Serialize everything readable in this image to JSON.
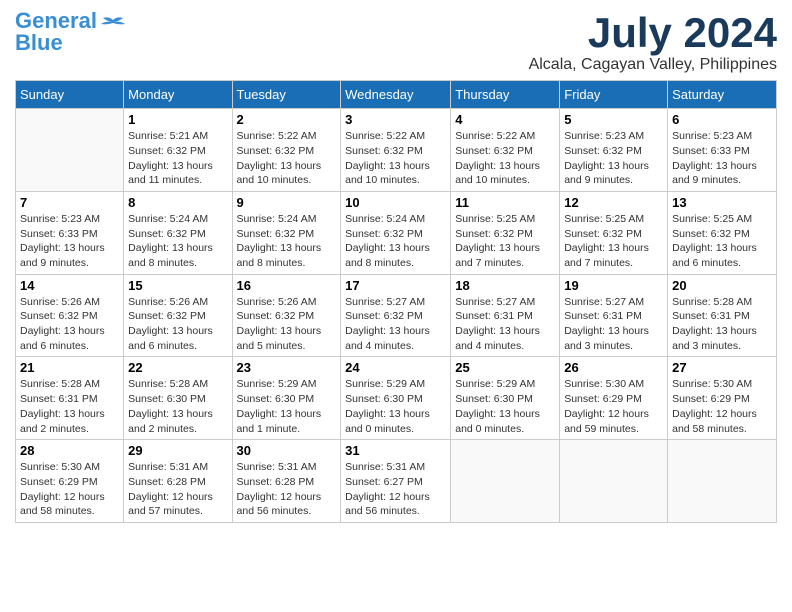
{
  "logo": {
    "line1": "General",
    "line2": "Blue"
  },
  "title": "July 2024",
  "location": "Alcala, Cagayan Valley, Philippines",
  "days_header": [
    "Sunday",
    "Monday",
    "Tuesday",
    "Wednesday",
    "Thursday",
    "Friday",
    "Saturday"
  ],
  "weeks": [
    [
      {
        "day": "",
        "info": ""
      },
      {
        "day": "1",
        "info": "Sunrise: 5:21 AM\nSunset: 6:32 PM\nDaylight: 13 hours\nand 11 minutes."
      },
      {
        "day": "2",
        "info": "Sunrise: 5:22 AM\nSunset: 6:32 PM\nDaylight: 13 hours\nand 10 minutes."
      },
      {
        "day": "3",
        "info": "Sunrise: 5:22 AM\nSunset: 6:32 PM\nDaylight: 13 hours\nand 10 minutes."
      },
      {
        "day": "4",
        "info": "Sunrise: 5:22 AM\nSunset: 6:32 PM\nDaylight: 13 hours\nand 10 minutes."
      },
      {
        "day": "5",
        "info": "Sunrise: 5:23 AM\nSunset: 6:32 PM\nDaylight: 13 hours\nand 9 minutes."
      },
      {
        "day": "6",
        "info": "Sunrise: 5:23 AM\nSunset: 6:33 PM\nDaylight: 13 hours\nand 9 minutes."
      }
    ],
    [
      {
        "day": "7",
        "info": "Sunrise: 5:23 AM\nSunset: 6:33 PM\nDaylight: 13 hours\nand 9 minutes."
      },
      {
        "day": "8",
        "info": "Sunrise: 5:24 AM\nSunset: 6:32 PM\nDaylight: 13 hours\nand 8 minutes."
      },
      {
        "day": "9",
        "info": "Sunrise: 5:24 AM\nSunset: 6:32 PM\nDaylight: 13 hours\nand 8 minutes."
      },
      {
        "day": "10",
        "info": "Sunrise: 5:24 AM\nSunset: 6:32 PM\nDaylight: 13 hours\nand 8 minutes."
      },
      {
        "day": "11",
        "info": "Sunrise: 5:25 AM\nSunset: 6:32 PM\nDaylight: 13 hours\nand 7 minutes."
      },
      {
        "day": "12",
        "info": "Sunrise: 5:25 AM\nSunset: 6:32 PM\nDaylight: 13 hours\nand 7 minutes."
      },
      {
        "day": "13",
        "info": "Sunrise: 5:25 AM\nSunset: 6:32 PM\nDaylight: 13 hours\nand 6 minutes."
      }
    ],
    [
      {
        "day": "14",
        "info": "Sunrise: 5:26 AM\nSunset: 6:32 PM\nDaylight: 13 hours\nand 6 minutes."
      },
      {
        "day": "15",
        "info": "Sunrise: 5:26 AM\nSunset: 6:32 PM\nDaylight: 13 hours\nand 6 minutes."
      },
      {
        "day": "16",
        "info": "Sunrise: 5:26 AM\nSunset: 6:32 PM\nDaylight: 13 hours\nand 5 minutes."
      },
      {
        "day": "17",
        "info": "Sunrise: 5:27 AM\nSunset: 6:32 PM\nDaylight: 13 hours\nand 4 minutes."
      },
      {
        "day": "18",
        "info": "Sunrise: 5:27 AM\nSunset: 6:31 PM\nDaylight: 13 hours\nand 4 minutes."
      },
      {
        "day": "19",
        "info": "Sunrise: 5:27 AM\nSunset: 6:31 PM\nDaylight: 13 hours\nand 3 minutes."
      },
      {
        "day": "20",
        "info": "Sunrise: 5:28 AM\nSunset: 6:31 PM\nDaylight: 13 hours\nand 3 minutes."
      }
    ],
    [
      {
        "day": "21",
        "info": "Sunrise: 5:28 AM\nSunset: 6:31 PM\nDaylight: 13 hours\nand 2 minutes."
      },
      {
        "day": "22",
        "info": "Sunrise: 5:28 AM\nSunset: 6:30 PM\nDaylight: 13 hours\nand 2 minutes."
      },
      {
        "day": "23",
        "info": "Sunrise: 5:29 AM\nSunset: 6:30 PM\nDaylight: 13 hours\nand 1 minute."
      },
      {
        "day": "24",
        "info": "Sunrise: 5:29 AM\nSunset: 6:30 PM\nDaylight: 13 hours\nand 0 minutes."
      },
      {
        "day": "25",
        "info": "Sunrise: 5:29 AM\nSunset: 6:30 PM\nDaylight: 13 hours\nand 0 minutes."
      },
      {
        "day": "26",
        "info": "Sunrise: 5:30 AM\nSunset: 6:29 PM\nDaylight: 12 hours\nand 59 minutes."
      },
      {
        "day": "27",
        "info": "Sunrise: 5:30 AM\nSunset: 6:29 PM\nDaylight: 12 hours\nand 58 minutes."
      }
    ],
    [
      {
        "day": "28",
        "info": "Sunrise: 5:30 AM\nSunset: 6:29 PM\nDaylight: 12 hours\nand 58 minutes."
      },
      {
        "day": "29",
        "info": "Sunrise: 5:31 AM\nSunset: 6:28 PM\nDaylight: 12 hours\nand 57 minutes."
      },
      {
        "day": "30",
        "info": "Sunrise: 5:31 AM\nSunset: 6:28 PM\nDaylight: 12 hours\nand 56 minutes."
      },
      {
        "day": "31",
        "info": "Sunrise: 5:31 AM\nSunset: 6:27 PM\nDaylight: 12 hours\nand 56 minutes."
      },
      {
        "day": "",
        "info": ""
      },
      {
        "day": "",
        "info": ""
      },
      {
        "day": "",
        "info": ""
      }
    ]
  ]
}
